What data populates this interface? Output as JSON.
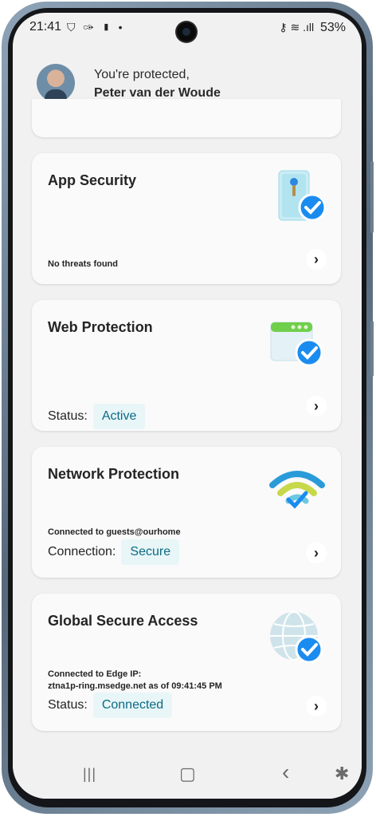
{
  "status_bar": {
    "time": "21:41",
    "left_icons": "⛉ ✑ ▮ •",
    "right_icons": "⚷ ≋ .ıll",
    "battery": "53%"
  },
  "header": {
    "greeting": "You're protected,",
    "user_name": "Peter van der Woude"
  },
  "cards": {
    "app_security": {
      "title": "App Security",
      "status_text": "No threats found"
    },
    "web_protection": {
      "title": "Web Protection",
      "status_label": "Status:",
      "status_value": "Active"
    },
    "network_protection": {
      "title": "Network Protection",
      "detail": "Connected to guests@ourhome",
      "connection_label": "Connection:",
      "connection_value": "Secure"
    },
    "global_secure_access": {
      "title": "Global Secure Access",
      "detail_line1": "Connected to Edge IP:",
      "detail_line2": "ztna1p-ring.msedge.net as of 09:41:45 PM",
      "status_label": "Status:",
      "status_value": "Connected"
    }
  },
  "chevron_glyph": "›",
  "nav_bar": {
    "recents": "|||",
    "home": "▢",
    "back": "‹",
    "accessibility": "✱"
  },
  "colors": {
    "pill_bg": "#e8f6f7",
    "pill_text": "#0b6a86",
    "check_blue": "#1a8cf0"
  }
}
